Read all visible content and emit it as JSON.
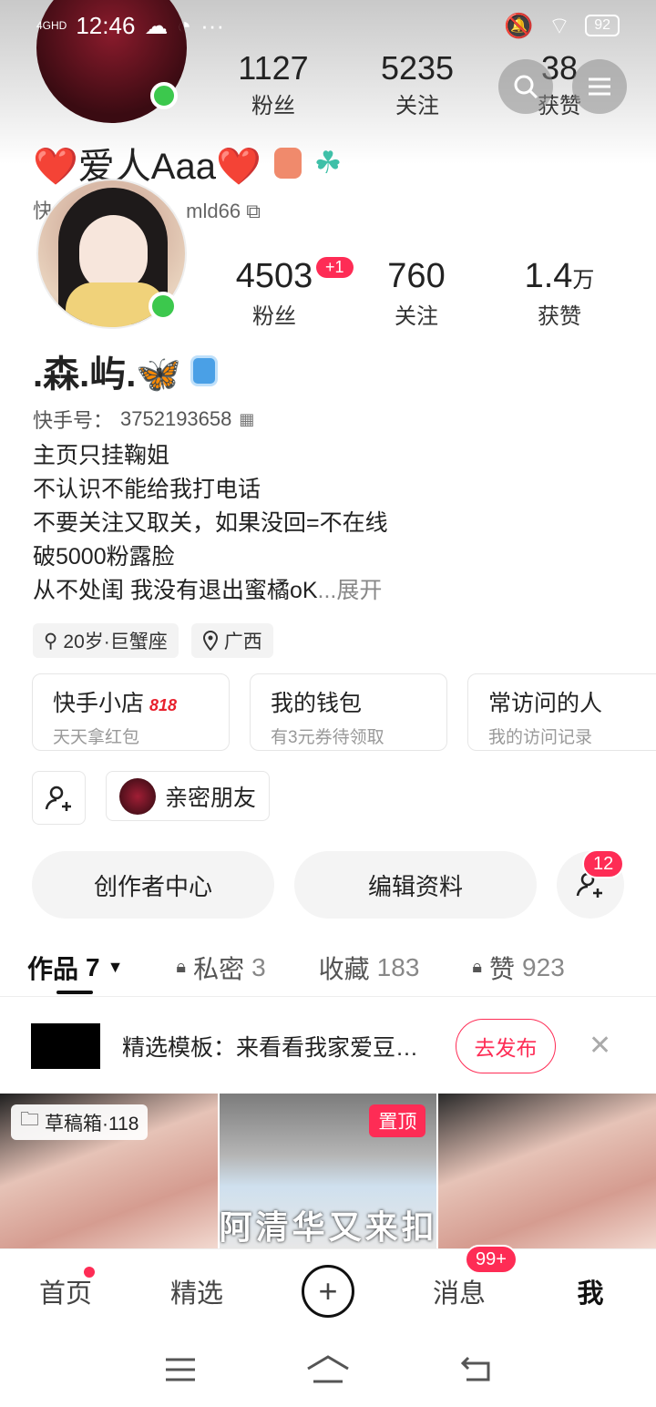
{
  "status_bar": {
    "network": "4GHD",
    "time": "12:46",
    "more": "···",
    "battery": "92"
  },
  "ghost_header": {
    "stats": [
      {
        "number": "1127",
        "label": "粉丝"
      },
      {
        "number": "5235",
        "label": "关注"
      },
      {
        "number": "38",
        "label": "获赞"
      }
    ],
    "name": "❤️爱人Aaa❤️",
    "id_fragment": "快",
    "id_tail": "mld66"
  },
  "profile": {
    "stats": [
      {
        "number": "4503",
        "label": "粉丝",
        "badge": "+1"
      },
      {
        "number": "760",
        "label": "关注"
      },
      {
        "number": "1.4",
        "unit": "万",
        "label": "获赞"
      }
    ],
    "name": ".森.屿.🦋",
    "uid_label": "快手号：",
    "uid": "3752193658",
    "bio_lines": [
      "主页只挂鞠姐",
      "不认识不能给我打电话",
      "不要关注又取关，如果没回=不在线",
      "破5000粉露脸",
      "从不处闺 我没有退出蜜橘oK"
    ],
    "bio_more": "...展开",
    "tags": [
      {
        "icon": "gender-icon",
        "text": "20岁·巨蟹座"
      },
      {
        "icon": "location-icon",
        "text": "广西"
      }
    ]
  },
  "cards": [
    {
      "title": "快手小店",
      "sale": "818",
      "subtitle": "天天拿红包"
    },
    {
      "title": "我的钱包",
      "subtitle": "有3元券待领取"
    },
    {
      "title": "常访问的人",
      "subtitle": "我的访问记录"
    }
  ],
  "close_friend_label": "亲密朋友",
  "actions": {
    "creator": "创作者中心",
    "edit": "编辑资料",
    "friend_requests": "12"
  },
  "tabs": [
    {
      "label": "作品",
      "count": "7"
    },
    {
      "label": "私密",
      "count": "3"
    },
    {
      "label": "收藏",
      "count": "183"
    },
    {
      "label": "赞",
      "count": "923"
    }
  ],
  "banner": {
    "text": "精选模板：来看看我家爱豆…",
    "button": "去发布"
  },
  "grid": {
    "draft": "草稿箱·118",
    "pinned": "置顶",
    "overlay_text": "阿清华又来扣"
  },
  "bottom_tabs": {
    "home": "首页",
    "featured": "精选",
    "messages": "消息",
    "messages_badge": "99+",
    "me": "我"
  }
}
